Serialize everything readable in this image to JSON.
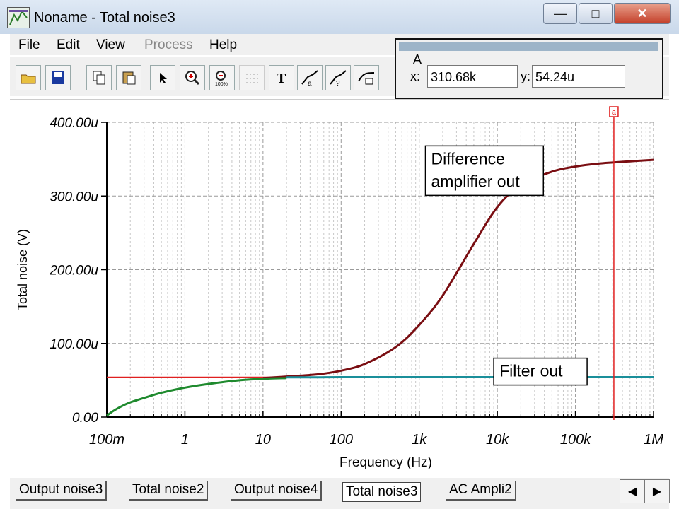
{
  "window": {
    "title": "Noname - Total noise3",
    "minimize_glyph": "—",
    "maximize_glyph": "□",
    "close_glyph": "✕"
  },
  "menu": [
    "File",
    "Edit",
    "View",
    "Process",
    "Help"
  ],
  "toolbar": {
    "icons": [
      "open-folder-icon",
      "save-icon",
      "copy-icon",
      "paste-icon",
      "pointer-icon",
      "zoom-in-icon",
      "zoom-100-icon",
      "grid-icon",
      "text-icon",
      "cursor-a-icon",
      "cursor-b-icon",
      "cursor-graph-icon"
    ]
  },
  "cursor_panel": {
    "group_label": "A",
    "x_label": "x:",
    "x_value": "310.68k",
    "y_label": "y:",
    "y_value": "54.24u"
  },
  "tabs": [
    {
      "label": "Output noise3",
      "active": false
    },
    {
      "label": "Total noise2",
      "active": false
    },
    {
      "label": "Output noise4",
      "active": false
    },
    {
      "label": "Total noise3",
      "active": true
    },
    {
      "label": "AC Ampli2",
      "active": false
    }
  ],
  "tab_scroll": {
    "left": "◀",
    "right": "▶"
  },
  "chart_data": {
    "type": "line",
    "xlabel": "Frequency (Hz)",
    "ylabel": "Total noise (V)",
    "x_scale": "log",
    "xlim": [
      0.1,
      1000000
    ],
    "ylim": [
      0,
      400
    ],
    "y_unit": "u",
    "x_ticks": [
      {
        "value": 0.1,
        "label": "100m"
      },
      {
        "value": 1,
        "label": "1"
      },
      {
        "value": 10,
        "label": "10"
      },
      {
        "value": 100,
        "label": "100"
      },
      {
        "value": 1000,
        "label": "1k"
      },
      {
        "value": 10000,
        "label": "10k"
      },
      {
        "value": 100000,
        "label": "100k"
      },
      {
        "value": 1000000,
        "label": "1M"
      }
    ],
    "y_ticks": [
      {
        "value": 0,
        "label": "0.00"
      },
      {
        "value": 100,
        "label": "100.00u"
      },
      {
        "value": 200,
        "label": "200.00u"
      },
      {
        "value": 300,
        "label": "300.00u"
      },
      {
        "value": 400,
        "label": "400.00u"
      }
    ],
    "grid": true,
    "series": [
      {
        "color": "#7a0e12",
        "x": [
          10,
          20,
          50,
          100,
          200,
          500,
          1000,
          2000,
          5000,
          10000,
          20000,
          50000,
          100000,
          200000,
          500000,
          1000000
        ],
        "y": [
          53,
          55,
          58,
          63,
          72,
          95,
          125,
          165,
          235,
          285,
          315,
          333,
          340,
          344,
          347,
          349
        ]
      },
      {
        "color": "#1f8a2e",
        "x": [
          0.1,
          0.12,
          0.15,
          0.2,
          0.3,
          0.5,
          1,
          2,
          5,
          10,
          20
        ],
        "y": [
          2,
          8,
          14,
          20,
          26,
          33,
          40,
          45,
          50,
          52,
          53
        ]
      },
      {
        "color": "#1a8f9a",
        "x": [
          20,
          50,
          100,
          1000,
          10000,
          100000,
          1000000
        ],
        "y": [
          54,
          54,
          54.24,
          54.24,
          54.24,
          54.24,
          54.24
        ]
      }
    ],
    "cursor": {
      "label": "a",
      "x": 310680,
      "y": 54.24,
      "color": "#e02020"
    },
    "annotations": [
      {
        "text": [
          "Difference",
          "amplifier out"
        ],
        "x": 1200,
        "y": 368
      },
      {
        "text": [
          "Filter out"
        ],
        "x": 9000,
        "y": 80
      }
    ]
  }
}
